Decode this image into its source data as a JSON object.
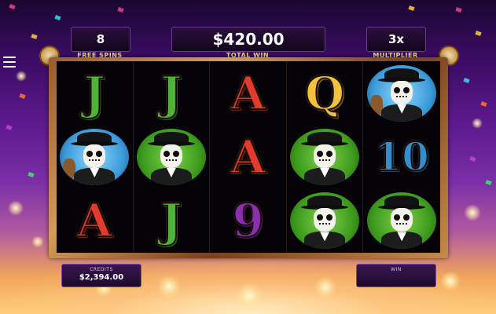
{
  "hud": {
    "free_spins_value": "8",
    "free_spins_label": "FREE SPINS",
    "total_win_value": "$420.00",
    "total_win_label": "TOTAL WIN",
    "multiplier_value": "3x",
    "multiplier_label": "MULTIPLIER"
  },
  "reels": [
    [
      {
        "type": "letter",
        "text": "J",
        "color": "green"
      },
      {
        "type": "portrait",
        "variant": "guitarist"
      },
      {
        "type": "letter",
        "text": "A",
        "color": "red"
      }
    ],
    [
      {
        "type": "letter",
        "text": "J",
        "color": "green"
      },
      {
        "type": "portrait",
        "variant": "man-green"
      },
      {
        "type": "letter",
        "text": "J",
        "color": "green"
      }
    ],
    [
      {
        "type": "letter",
        "text": "A",
        "color": "red"
      },
      {
        "type": "letter",
        "text": "A",
        "color": "red"
      },
      {
        "type": "letter",
        "text": "9",
        "color": "purple"
      }
    ],
    [
      {
        "type": "letter",
        "text": "Q",
        "color": "gold"
      },
      {
        "type": "portrait",
        "variant": "man-green"
      },
      {
        "type": "portrait",
        "variant": "man-green"
      }
    ],
    [
      {
        "type": "portrait",
        "variant": "guitarist"
      },
      {
        "type": "letter",
        "text": "10",
        "color": "blue"
      },
      {
        "type": "portrait",
        "variant": "man-green"
      }
    ]
  ],
  "footer": {
    "credits_label": "CREDITS",
    "credits_value": "$2,394.00",
    "win_label": "WIN",
    "win_value": ""
  },
  "colors": {
    "letter_red": "#e23a2c",
    "letter_green": "#4fb33a",
    "letter_gold": "#f3c23c",
    "letter_blue": "#2f8fd0",
    "letter_purple": "#8a2fb0",
    "hud_caption": "#f7d780"
  },
  "icons": {
    "menu": "hamburger-menu-icon"
  }
}
